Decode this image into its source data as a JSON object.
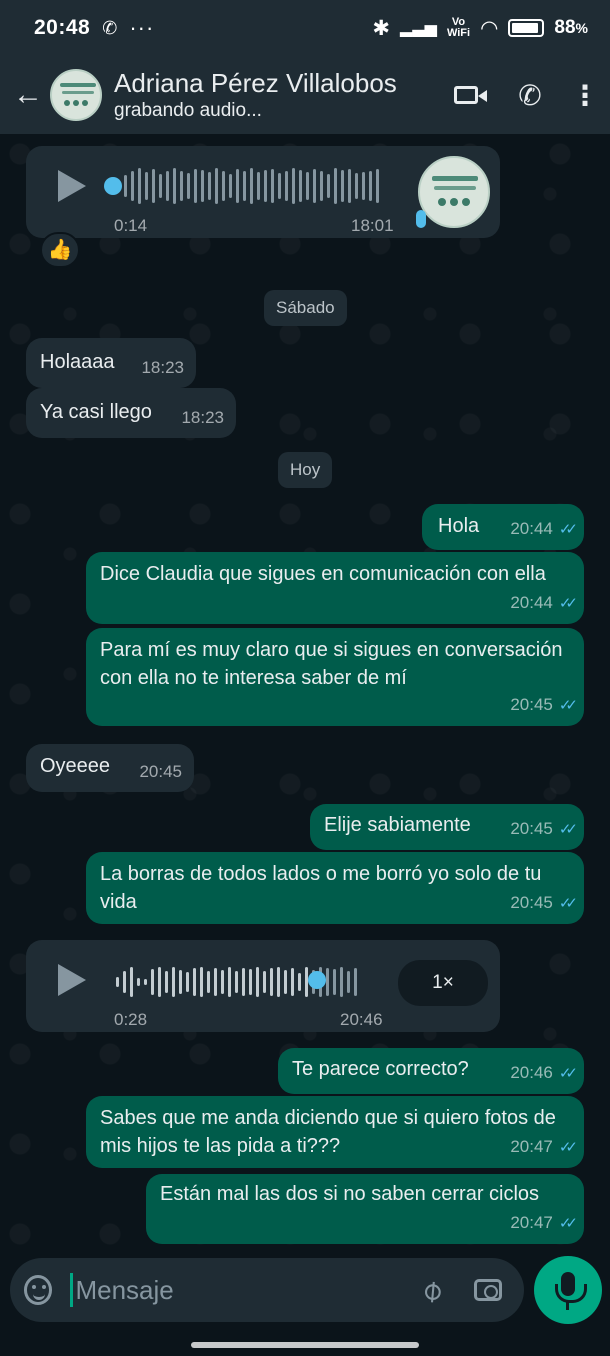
{
  "statusbar": {
    "time": "20:48",
    "whatsapp_icon": "whatsapp-icon",
    "more": "···",
    "volte_top": "Vo",
    "volte_bottom": "WiFi",
    "battery": "88",
    "battery_unit": "%"
  },
  "header": {
    "contact_name": "Adriana Pérez Villalobos",
    "status": "grabando audio..."
  },
  "messages": {
    "audio1": {
      "duration": "0:14",
      "time": "18:01"
    },
    "reaction": "👍",
    "day1": "Sábado",
    "m1": {
      "text": "Holaaaa",
      "time": "18:23"
    },
    "m2": {
      "text": "Ya casi llego",
      "time": "18:23"
    },
    "day2": "Hoy",
    "m3": {
      "text": "Hola",
      "time": "20:44"
    },
    "m4": {
      "text": "Dice Claudia que sigues en comunicación con ella",
      "time": "20:44"
    },
    "m5": {
      "text": "Para mí es muy claro que si sigues en conversación con ella no te interesa saber de mí",
      "time": "20:45"
    },
    "m6": {
      "text": "Oyeeee",
      "time": "20:45"
    },
    "m7": {
      "text": "Elije sabiamente",
      "time": "20:45"
    },
    "m8": {
      "text": "La borras de todos lados o me borró yo solo de tu vida",
      "time": "20:45"
    },
    "audio2": {
      "duration": "0:28",
      "time": "20:46",
      "speed": "1×"
    },
    "m9": {
      "text": "Te parece correcto?",
      "time": "20:46"
    },
    "m10": {
      "text": "Sabes que me anda diciendo que si quiero fotos de mis hijos te las pida a ti???",
      "time": "20:47"
    },
    "m11": {
      "text": "Están mal las dos si no saben cerrar ciclos",
      "time": "20:47"
    }
  },
  "input": {
    "placeholder": "Mensaje"
  },
  "colors": {
    "incoming": "#1f2c34",
    "outgoing": "#005c4b",
    "accent": "#00a884",
    "read_tick": "#53bdeb"
  }
}
